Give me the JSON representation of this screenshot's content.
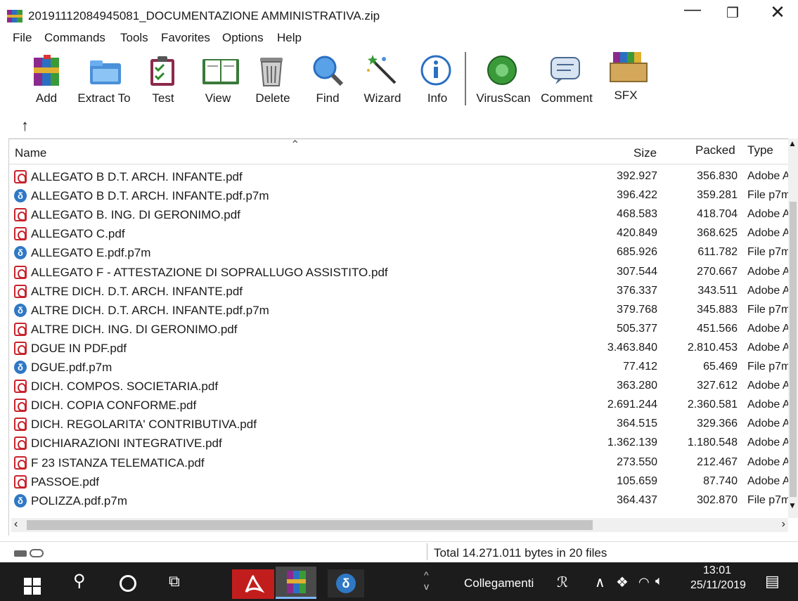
{
  "window": {
    "title": "20191112084945081_DOCUMENTAZIONE AMMINISTRATIVA.zip",
    "controls": {
      "minimize": "—",
      "maximize": "❐",
      "close": "✕"
    }
  },
  "menu": [
    "File",
    "Commands",
    "Tools",
    "Favorites",
    "Options",
    "Help"
  ],
  "toolbar": [
    {
      "label": "Add",
      "icon": "add-archive-icon"
    },
    {
      "label": "Extract To",
      "icon": "extract-folder-icon"
    },
    {
      "label": "Test",
      "icon": "test-clipboard-icon"
    },
    {
      "label": "View",
      "icon": "view-book-icon"
    },
    {
      "label": "Delete",
      "icon": "trash-icon"
    },
    {
      "label": "Find",
      "icon": "magnifier-icon"
    },
    {
      "label": "Wizard",
      "icon": "magic-wand-icon"
    },
    {
      "label": "Info",
      "icon": "info-icon"
    },
    {
      "label": "VirusScan",
      "icon": "virus-scan-icon"
    },
    {
      "label": "Comment",
      "icon": "comment-icon"
    },
    {
      "label": "SFX",
      "icon": "sfx-box-icon"
    }
  ],
  "nav": {
    "up": "↑"
  },
  "list": {
    "headers": {
      "name": "Name",
      "size": "Size",
      "packed": "Packed",
      "type": "Type"
    },
    "rows": [
      {
        "name": "ALLEGATO B D.T. ARCH. INFANTE.pdf",
        "size": "392.927",
        "packed": "356.830",
        "type": "Adobe A",
        "kind": "pdf"
      },
      {
        "name": "ALLEGATO B D.T. ARCH. INFANTE.pdf.p7m",
        "size": "396.422",
        "packed": "359.281",
        "type": "File p7m",
        "kind": "p7m"
      },
      {
        "name": "ALLEGATO B. ING.  DI GERONIMO.pdf",
        "size": "468.583",
        "packed": "418.704",
        "type": "Adobe A",
        "kind": "pdf"
      },
      {
        "name": "ALLEGATO C.pdf",
        "size": "420.849",
        "packed": "368.625",
        "type": "Adobe A",
        "kind": "pdf"
      },
      {
        "name": "ALLEGATO E.pdf.p7m",
        "size": "685.926",
        "packed": "611.782",
        "type": "File p7m",
        "kind": "p7m"
      },
      {
        "name": "ALLEGATO F - ATTESTAZIONE DI SOPRALLUGO ASSISTITO.pdf",
        "size": "307.544",
        "packed": "270.667",
        "type": "Adobe A",
        "kind": "pdf"
      },
      {
        "name": "ALTRE DICH. D.T. ARCH. INFANTE.pdf",
        "size": "376.337",
        "packed": "343.511",
        "type": "Adobe A",
        "kind": "pdf"
      },
      {
        "name": "ALTRE DICH. D.T. ARCH. INFANTE.pdf.p7m",
        "size": "379.768",
        "packed": "345.883",
        "type": "File p7m",
        "kind": "p7m"
      },
      {
        "name": "ALTRE DICH. ING. DI GERONIMO.pdf",
        "size": "505.377",
        "packed": "451.566",
        "type": "Adobe A",
        "kind": "pdf"
      },
      {
        "name": "DGUE IN PDF.pdf",
        "size": "3.463.840",
        "packed": "2.810.453",
        "type": "Adobe A",
        "kind": "pdf"
      },
      {
        "name": "DGUE.pdf.p7m",
        "size": "77.412",
        "packed": "65.469",
        "type": "File p7m",
        "kind": "p7m"
      },
      {
        "name": "DICH. COMPOS. SOCIETARIA.pdf",
        "size": "363.280",
        "packed": "327.612",
        "type": "Adobe A",
        "kind": "pdf"
      },
      {
        "name": "DICH. COPIA CONFORME.pdf",
        "size": "2.691.244",
        "packed": "2.360.581",
        "type": "Adobe A",
        "kind": "pdf"
      },
      {
        "name": "DICH. REGOLARITA' CONTRIBUTIVA.pdf",
        "size": "364.515",
        "packed": "329.366",
        "type": "Adobe A",
        "kind": "pdf"
      },
      {
        "name": "DICHIARAZIONI INTEGRATIVE.pdf",
        "size": "1.362.139",
        "packed": "1.180.548",
        "type": "Adobe A",
        "kind": "pdf"
      },
      {
        "name": "F 23 ISTANZA TELEMATICA.pdf",
        "size": "273.550",
        "packed": "212.467",
        "type": "Adobe A",
        "kind": "pdf"
      },
      {
        "name": "PASSOE.pdf",
        "size": "105.659",
        "packed": "87.740",
        "type": "Adobe A",
        "kind": "pdf"
      },
      {
        "name": "POLIZZA.pdf.p7m",
        "size": "364.437",
        "packed": "302.870",
        "type": "File p7m",
        "kind": "p7m"
      }
    ]
  },
  "status": {
    "text": "Total 14.271.011 bytes in 20 files"
  },
  "taskbar": {
    "toolbar_label": "Collegamenti",
    "time": "13:01",
    "date": "25/11/2019"
  },
  "colors": {
    "pdf": "#c8232c",
    "p7m": "#2f78c4",
    "taskbar": "#1c1c1c"
  }
}
